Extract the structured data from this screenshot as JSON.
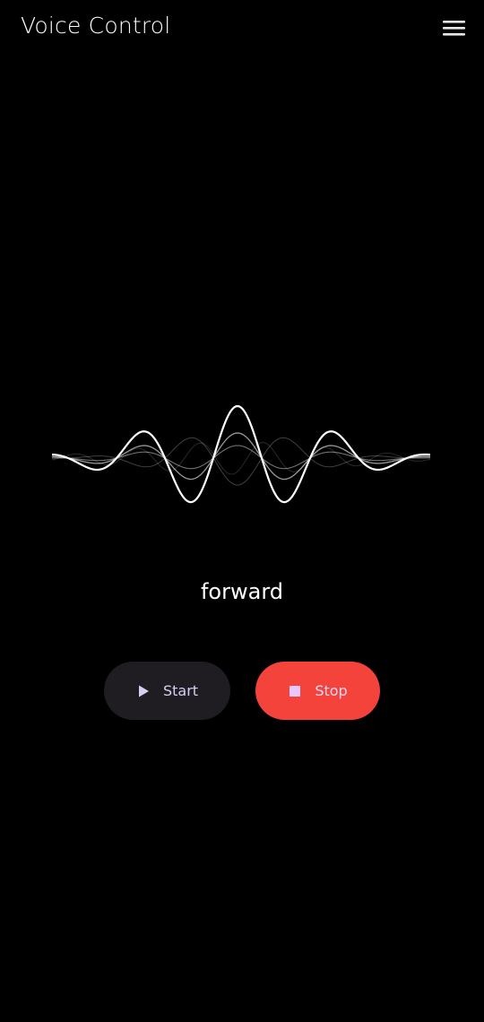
{
  "app_bar": {
    "title": "Voice Control",
    "menu_icon": "hamburger-menu-icon"
  },
  "visualizer": {
    "icon": "voice-waveform"
  },
  "recognized": {
    "text": "forward"
  },
  "controls": {
    "start": {
      "label": "Start",
      "icon": "play-icon",
      "background": "#1f1d22",
      "accent": "#d9cdf2"
    },
    "stop": {
      "label": "Stop",
      "icon": "stop-icon",
      "background": "#f4433a",
      "accent": "#e6c9ff"
    }
  },
  "colors": {
    "background": "#000000",
    "text": "#ffffff"
  }
}
